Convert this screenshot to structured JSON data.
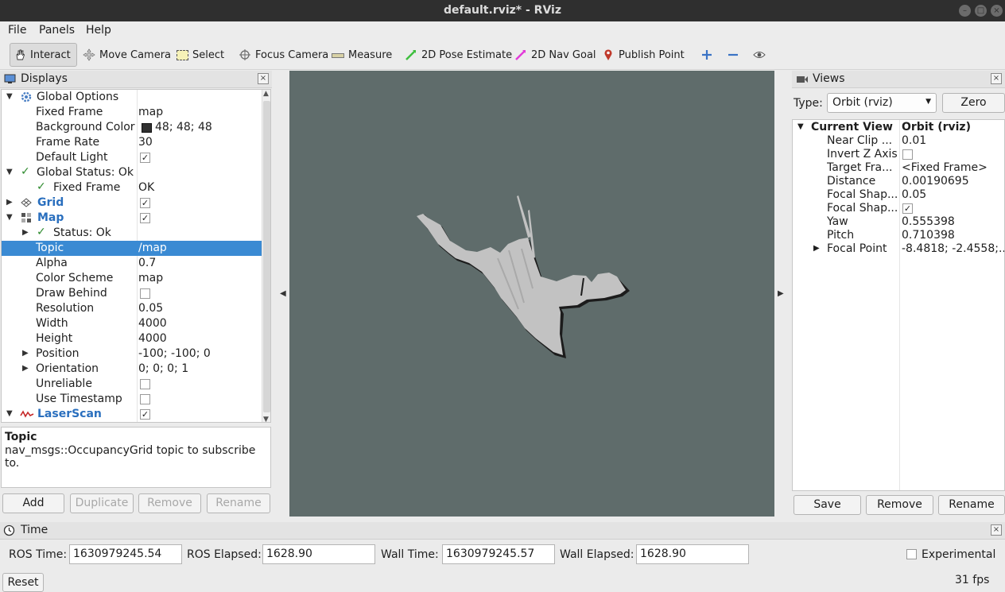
{
  "window": {
    "title": "default.rviz* - RViz"
  },
  "menu": [
    "File",
    "Panels",
    "Help"
  ],
  "toolbar": {
    "interact": "Interact",
    "move_camera": "Move Camera",
    "select": "Select",
    "focus_camera": "Focus Camera",
    "measure": "Measure",
    "pose_estimate": "2D Pose Estimate",
    "nav_goal": "2D Nav Goal",
    "publish_point": "Publish Point"
  },
  "displays": {
    "title": "Displays",
    "rows": {
      "global_options": "Global Options",
      "fixed_frame": "Fixed Frame",
      "fixed_frame_val": "map",
      "background_color": "Background Color",
      "background_color_val": "48; 48; 48",
      "frame_rate": "Frame Rate",
      "frame_rate_val": "30",
      "default_light": "Default Light",
      "global_status": "Global Status: Ok",
      "status_fixed_frame": "Fixed Frame",
      "status_fixed_frame_val": "OK",
      "grid": "Grid",
      "map": "Map",
      "map_status": "Status: Ok",
      "topic": "Topic",
      "topic_val": "/map",
      "alpha": "Alpha",
      "alpha_val": "0.7",
      "color_scheme": "Color Scheme",
      "color_scheme_val": "map",
      "draw_behind": "Draw Behind",
      "resolution": "Resolution",
      "resolution_val": "0.05",
      "width": "Width",
      "width_val": "4000",
      "height": "Height",
      "height_val": "4000",
      "position": "Position",
      "position_val": "-100; -100; 0",
      "orientation": "Orientation",
      "orientation_val": "0; 0; 0; 1",
      "unreliable": "Unreliable",
      "use_timestamp": "Use Timestamp",
      "laserscan": "LaserScan"
    },
    "description": {
      "title": "Topic",
      "text": "nav_msgs::OccupancyGrid topic to subscribe to."
    },
    "buttons": {
      "add": "Add",
      "duplicate": "Duplicate",
      "remove": "Remove",
      "rename": "Rename"
    }
  },
  "views": {
    "title": "Views",
    "type_label": "Type:",
    "type_value": "Orbit (rviz)",
    "zero": "Zero",
    "current_view": "Current View",
    "current_view_val": "Orbit (rviz)",
    "rows": [
      {
        "name": "Near Clip ...",
        "value": "0.01"
      },
      {
        "name": "Invert Z Axis",
        "value": ""
      },
      {
        "name": "Target Fra...",
        "value": "<Fixed Frame>"
      },
      {
        "name": "Distance",
        "value": "0.00190695"
      },
      {
        "name": "Focal Shap...",
        "value": "0.05"
      },
      {
        "name": "Focal Shap...",
        "value": ""
      },
      {
        "name": "Yaw",
        "value": "0.555398"
      },
      {
        "name": "Pitch",
        "value": "0.710398"
      },
      {
        "name": "Focal Point",
        "value": "-8.4818; -2.4558;..."
      }
    ],
    "buttons": {
      "save": "Save",
      "remove": "Remove",
      "rename": "Rename"
    }
  },
  "time": {
    "title": "Time",
    "ros_time_label": "ROS Time:",
    "ros_time": "1630979245.54",
    "ros_elapsed_label": "ROS Elapsed:",
    "ros_elapsed": "1628.90",
    "wall_time_label": "Wall Time:",
    "wall_time": "1630979245.57",
    "wall_elapsed_label": "Wall Elapsed:",
    "wall_elapsed": "1628.90",
    "experimental": "Experimental",
    "reset": "Reset",
    "fps": "31 fps"
  },
  "colors": {
    "viewport_bg": "#5f6c6b",
    "map_free": "#bdbdbd",
    "selection": "#3a8ad3",
    "link": "#2a6fbe",
    "titlebar": "#2f2f2f"
  }
}
